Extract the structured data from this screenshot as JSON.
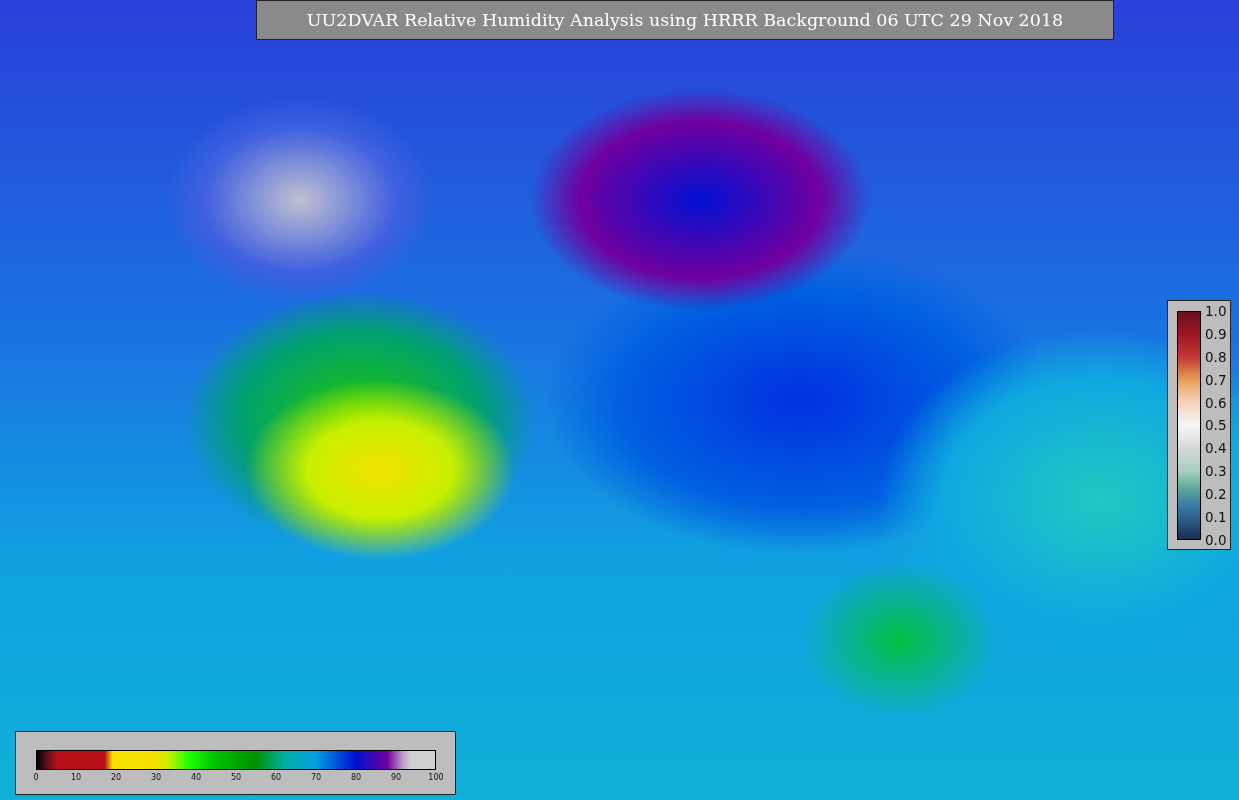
{
  "title": "UU2DVAR Relative Humidity Analysis using HRRR Background 06 UTC 29 Nov 2018",
  "observation_colorbar": {
    "ticks": [
      "1.0",
      "0.9",
      "0.8",
      "0.7",
      "0.6",
      "0.5",
      "0.4",
      "0.3",
      "0.2",
      "0.1",
      "0.0"
    ]
  },
  "humidity_colorbar": {
    "ticks": [
      "0",
      "10",
      "20",
      "30",
      "40",
      "50",
      "60",
      "70",
      "80",
      "90",
      "100"
    ]
  }
}
